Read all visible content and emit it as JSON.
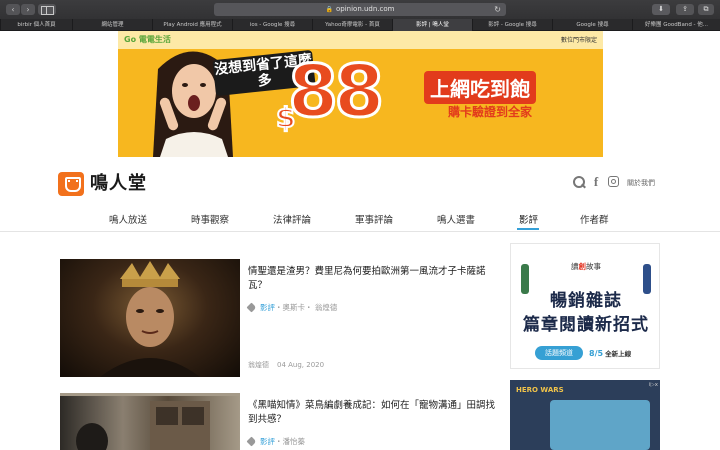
{
  "browser": {
    "url": "opinion.udn.com",
    "tabs": [
      {
        "label": "birbir 個人首頁"
      },
      {
        "label": "網站管理"
      },
      {
        "label": "Play Android 應用程式"
      },
      {
        "label": "ios - Google 搜尋"
      },
      {
        "label": "Yahoo奇摩電影 - 首頁"
      },
      {
        "label": "影評 | 鳴人堂"
      },
      {
        "label": "影評 - Google 搜尋"
      },
      {
        "label": "Google 搜尋"
      },
      {
        "label": "好樂團 GoodBand - 他..."
      }
    ]
  },
  "banner": {
    "logo": "Go 電電生活",
    "note": "數位門市限定",
    "headline": "沒想到省了這麼多",
    "currency": "$",
    "price": "88",
    "slogan": "上網吃到飽",
    "subslogan": "購卡驗證到全家"
  },
  "site": {
    "name": "鳴人堂",
    "about": "關於我們"
  },
  "nav": {
    "items": [
      {
        "label": "鳴人放送"
      },
      {
        "label": "時事觀察"
      },
      {
        "label": "法律評論"
      },
      {
        "label": "軍事評論"
      },
      {
        "label": "鳴人選書"
      },
      {
        "label": "影評"
      },
      {
        "label": "作者群"
      }
    ]
  },
  "articles": [
    {
      "title": "情聖還是渣男？費里尼為何要拍歐洲第一風流才子卡薩諾瓦？",
      "category": "影評",
      "tags": "・奧斯卡・ 翁煌德",
      "author": "翁煌德",
      "date": "04 Aug, 2020"
    },
    {
      "title": "《黑喵知情》菜鳥編劇養成記：如何在「寵物溝通」田調找到共感？",
      "category": "影評",
      "tags": "・潘怡蓁"
    }
  ],
  "sidebar_ads": {
    "ad1": {
      "brand_prefix": "讀",
      "brand_accent": "創",
      "brand_suffix": "故事",
      "line1": "暢銷雜誌",
      "line2": "篇章閱讀新招式",
      "pill": "話題頻道",
      "date": "8/5",
      "date_suffix": "全新上線"
    },
    "ad2": {
      "logo": "HERO WARS",
      "badge": "i▷x"
    }
  }
}
